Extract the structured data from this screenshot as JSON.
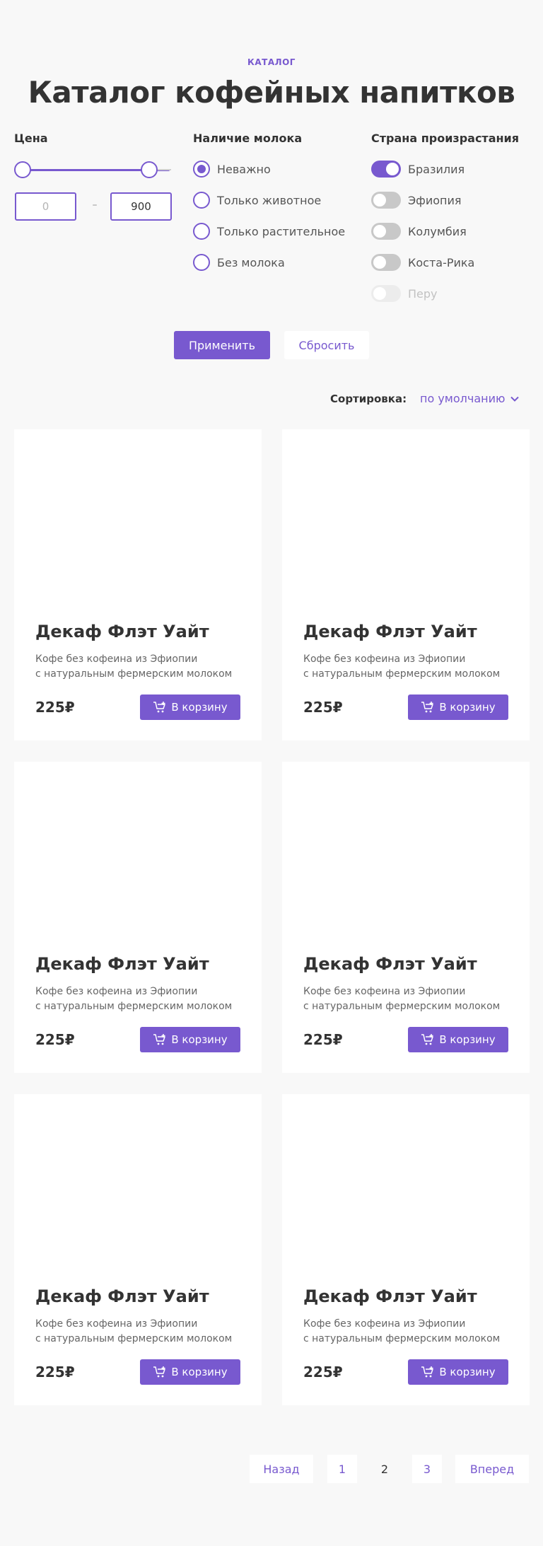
{
  "header": {
    "eyebrow": "КАТАЛОГ",
    "title": "Каталог кофейных напитков"
  },
  "filters": {
    "price": {
      "heading": "Цена",
      "min_placeholder": "0",
      "max_value": "900",
      "dash": "–"
    },
    "milk": {
      "heading": "Наличие молока",
      "options": [
        {
          "label": "Неважно",
          "checked": true
        },
        {
          "label": "Только животное",
          "checked": false
        },
        {
          "label": "Только растительное",
          "checked": false
        },
        {
          "label": "Без молока",
          "checked": false
        }
      ]
    },
    "country": {
      "heading": "Страна произрастания",
      "options": [
        {
          "label": "Бразилия",
          "state": "on"
        },
        {
          "label": "Эфиопия",
          "state": "off"
        },
        {
          "label": "Колумбия",
          "state": "off"
        },
        {
          "label": "Коста-Рика",
          "state": "off"
        },
        {
          "label": "Перу",
          "state": "disabled"
        }
      ]
    },
    "apply_label": "Применить",
    "reset_label": "Сбросить"
  },
  "sort": {
    "label": "Сортировка:",
    "value": "по умолчанию",
    "icon": "chevron-down-icon"
  },
  "products": [
    {
      "title": "Декаф Флэт Уайт",
      "desc_line1": "Кофе без кофеина из Эфиопии",
      "desc_line2": "с натуральным фермерским молоком",
      "price": "225₽",
      "button": "В корзину"
    },
    {
      "title": "Декаф Флэт Уайт",
      "desc_line1": "Кофе без кофеина из Эфиопии",
      "desc_line2": "с натуральным фермерским молоком",
      "price": "225₽",
      "button": "В корзину"
    },
    {
      "title": "Декаф Флэт Уайт",
      "desc_line1": "Кофе без кофеина из Эфиопии",
      "desc_line2": "с натуральным фермерским молоком",
      "price": "225₽",
      "button": "В корзину"
    },
    {
      "title": "Декаф Флэт Уайт",
      "desc_line1": "Кофе без кофеина из Эфиопии",
      "desc_line2": "с натуральным фермерским молоком",
      "price": "225₽",
      "button": "В корзину"
    },
    {
      "title": "Декаф Флэт Уайт",
      "desc_line1": "Кофе без кофеина из Эфиопии",
      "desc_line2": "с натуральным фермерским молоком",
      "price": "225₽",
      "button": "В корзину"
    },
    {
      "title": "Декаф Флэт Уайт",
      "desc_line1": "Кофе без кофеина из Эфиопии",
      "desc_line2": "с натуральным фермерским молоком",
      "price": "225₽",
      "button": "В корзину"
    }
  ],
  "pagination": {
    "prev": "Назад",
    "pages": [
      "1",
      "2",
      "3"
    ],
    "current": "2",
    "next": "Вперед"
  },
  "colors": {
    "accent": "#7859cf",
    "text": "#333333",
    "background": "#f8f8f8"
  }
}
